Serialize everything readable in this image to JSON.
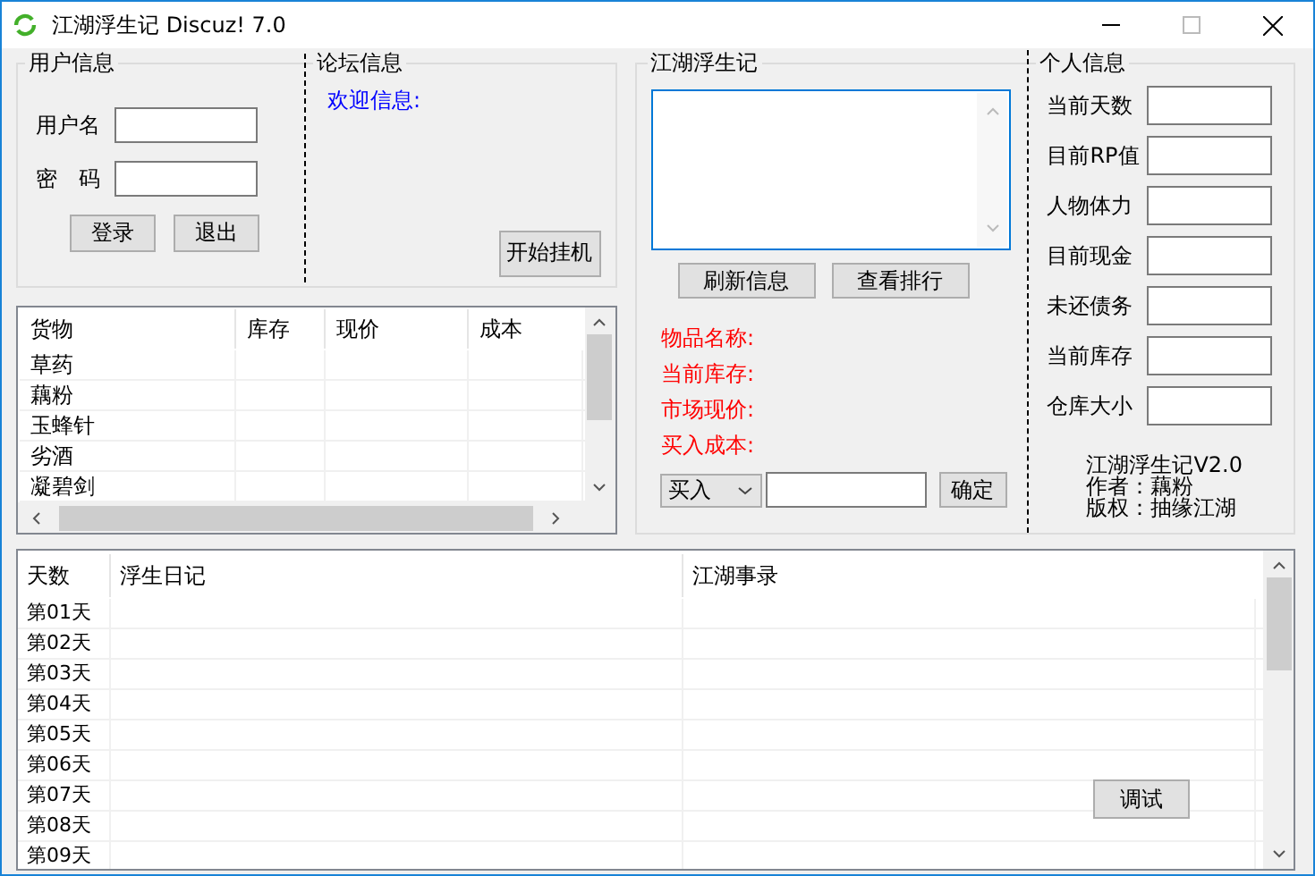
{
  "window": {
    "title": "江湖浮生记 Discuz! 7.0"
  },
  "user_info": {
    "title": "用户信息",
    "fields": [
      {
        "label": "用户名"
      },
      {
        "label": "密　码"
      }
    ],
    "buttons": [
      "登录",
      "退出"
    ]
  },
  "forum_info": {
    "title": "论坛信息",
    "welcome": "欢迎信息:",
    "button": "开始挂机"
  },
  "goods_table": {
    "columns": [
      "货物",
      "库存",
      "现价",
      "成本"
    ],
    "rows": [
      "草药",
      "藕粉",
      "玉蜂针",
      "劣酒",
      "凝碧剑"
    ]
  },
  "game": {
    "title": "江湖浮生记",
    "buttons": [
      "刷新信息",
      "查看排行"
    ],
    "labels": [
      "物品名称:",
      "当前库存:",
      "市场现价:",
      "买入成本:"
    ],
    "trade": {
      "action": "买入",
      "button": "确定"
    }
  },
  "personal": {
    "title": "个人信息",
    "fields": [
      "当前天数",
      "目前RP值",
      "人物体力",
      "目前现金",
      "未还债务",
      "当前库存",
      "仓库大小"
    ],
    "credits": [
      "江湖浮生记V2.0",
      "作者：藕粉",
      "版权：抽缘江湖"
    ]
  },
  "log_table": {
    "columns": [
      "天数",
      "浮生日记",
      "江湖事录"
    ],
    "rows": [
      "第01天",
      "第02天",
      "第03天",
      "第04天",
      "第05天",
      "第06天",
      "第07天",
      "第08天",
      "第09天"
    ],
    "button": "调试"
  }
}
